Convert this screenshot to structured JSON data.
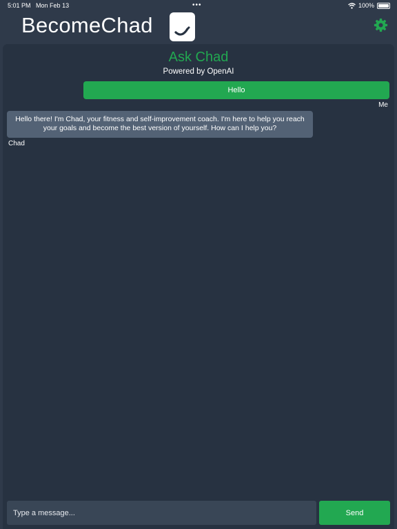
{
  "status_bar": {
    "time": "5:01 PM",
    "date": "Mon Feb 13",
    "dots": "•••",
    "battery": "100%",
    "icons": [
      "wifi-icon",
      "battery-icon"
    ]
  },
  "header": {
    "brand": "BecomeChad",
    "logo_icon": "chad-logo-icon",
    "settings_icon": "gear-icon"
  },
  "chat": {
    "title": "Ask Chad",
    "subtitle": "Powered by OpenAI",
    "messages": [
      {
        "sender": "Me",
        "text": "Hello"
      },
      {
        "sender": "Chad",
        "text": "Hello there! I'm Chad, your fitness and self-improvement coach. I'm here to help you reach your goals and become the best version of yourself. How can I help you?"
      }
    ]
  },
  "composer": {
    "placeholder": "Type a message...",
    "value": "",
    "send_label": "Send"
  },
  "colors": {
    "accent": "#22a851",
    "background": "#2f3a4a",
    "panel": "#273241",
    "bot_bubble": "#536275"
  }
}
